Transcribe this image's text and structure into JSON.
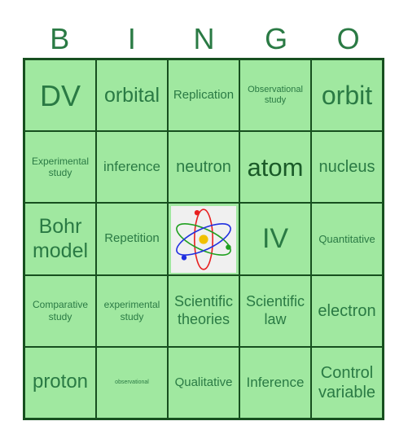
{
  "header": [
    "B",
    "I",
    "N",
    "G",
    "O"
  ],
  "cells": [
    [
      "DV",
      "orbital",
      "Replication",
      "Observational study",
      "orbit"
    ],
    [
      "Experimental study",
      "inference",
      "neutron",
      "atom",
      "nucleus"
    ],
    [
      "Bohr model",
      "Repetition",
      "",
      "IV",
      "Quantitative"
    ],
    [
      "Comparative study",
      "experimental study",
      "Scientific theories",
      "Scientific law",
      "electron"
    ],
    [
      "proton",
      "observational",
      "Qualitative",
      "Inference",
      "Control variable"
    ]
  ],
  "center_icon": "atom-icon",
  "colors": {
    "cell": "#a0e8a0",
    "border": "#174f1f",
    "text": "#2a7a44"
  }
}
